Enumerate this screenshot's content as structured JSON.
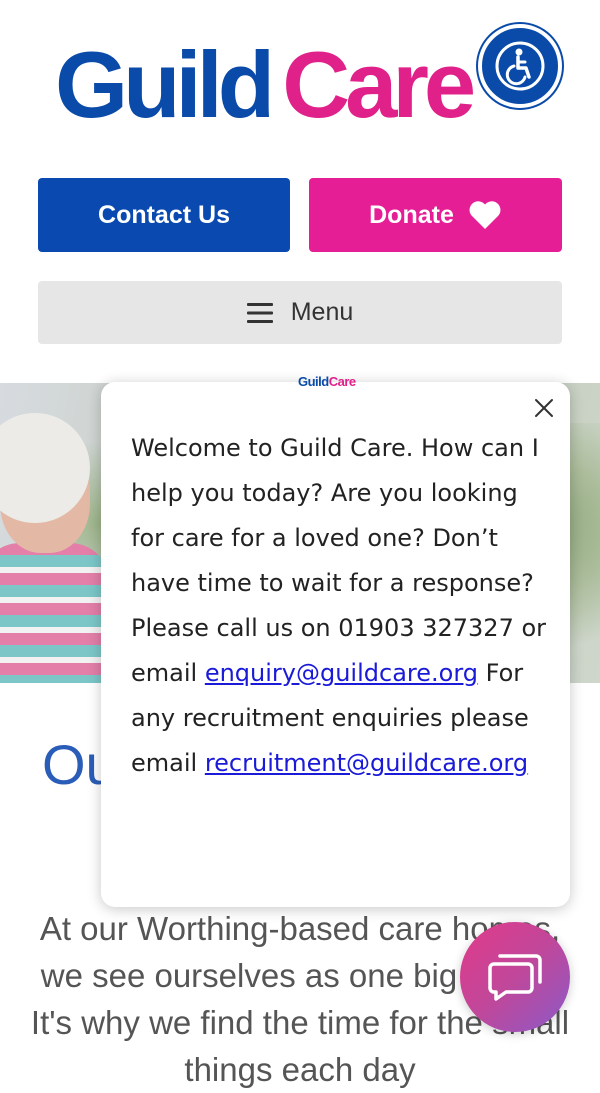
{
  "header": {
    "logo_guild": "Guild",
    "logo_care": "Care",
    "contact_label": "Contact Us",
    "donate_label": "Donate",
    "menu_label": "Menu"
  },
  "chat": {
    "logo_guild": "Guild",
    "logo_care": "Care",
    "message_part1": "Welcome to Guild Care. How can I help you today? Are you looking for care for a loved one? Don’t have time to wait for a response? Please call us on 01903 327327 or email",
    "email_enquiry": "enquiry@guildcare.org",
    "message_part2": "For any recruitment enquiries please email",
    "email_recruitment": "recruitment@guildcare.org"
  },
  "page": {
    "title_fragment": "Ou",
    "intro": "At our Worthing-based care homes, we see ourselves as one big family. It's why we find the time for the small things each day"
  },
  "colors": {
    "brand_blue": "#0a4aa8",
    "brand_pink": "#e0218a",
    "menu_bg": "#e6e6e6"
  },
  "icons": {
    "accessibility": "wheelchair-icon",
    "donate": "heart-icon",
    "menu": "hamburger-icon",
    "close": "close-icon",
    "chat": "chat-icon"
  }
}
